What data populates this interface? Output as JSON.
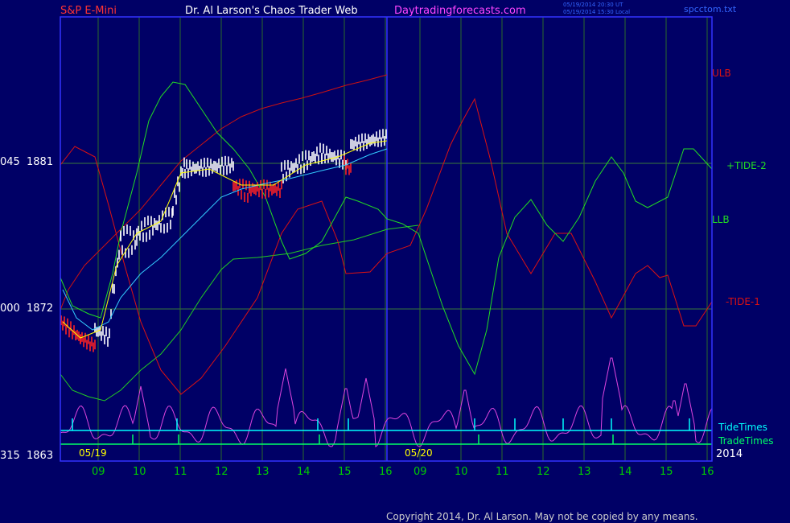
{
  "header": {
    "symbol": "S&P E-Mini",
    "site_title": "Dr. Al Larson's Chaos Trader Web",
    "site_url": "Daytradingforecasts.com",
    "timestamp_line1": "05/19/2014 20:30 UT",
    "timestamp_line2": "05/19/2014 15:30 Local",
    "file_name": "spcctom.txt"
  },
  "footer": {
    "copyright": "Copyright 2014, Dr. Al Larson. May not be copied by any means."
  },
  "colors": {
    "background": "#000066",
    "frame": "#3333ff",
    "grid_h": "#3a7a3a",
    "grid_v": "#2a6a2a",
    "axis_label": "#ffffff",
    "date_label": "#ffff00",
    "hour_label": "#00cc00",
    "ulb": "#dd1111",
    "tide2": "#22dd22",
    "llb": "#22dd22",
    "tide1": "#dd1111",
    "upper_band": "#cc1111",
    "lower_band": "#22cc22",
    "ma": "#33ccff",
    "ma_fast": "#ffff00",
    "bar_up": "#ffffff",
    "bar_down": "#ff2222",
    "energy": "#dd44dd",
    "tide_times": "#00ffff",
    "trade_times": "#00ff66",
    "symbol_text": "#ff3333",
    "site_title_text": "#ffffff",
    "site_url_text": "#ff44ff",
    "timestamp_text": "#3366ff",
    "copyright_text": "#cccccc"
  },
  "chart_data": {
    "type": "line",
    "title": "S&P E-Mini",
    "y_axis_labels": [
      {
        "code": "045",
        "price": "1881"
      },
      {
        "code": "000",
        "price": "1872"
      },
      {
        "code": "315",
        "price": "1863"
      }
    ],
    "x_hour_ticks": [
      "09",
      "10",
      "11",
      "12",
      "13",
      "14",
      "15",
      "16",
      "09",
      "10",
      "11",
      "12",
      "13",
      "14",
      "15",
      "16"
    ],
    "date_labels": [
      "05/19",
      "05/20"
    ],
    "year_label": "2014",
    "series_labels": [
      {
        "key": "ulb",
        "label": "ULB"
      },
      {
        "key": "tide2",
        "label": "+TIDE-2"
      },
      {
        "key": "llb",
        "label": "LLB"
      },
      {
        "key": "tide1",
        "label": "-TIDE-1"
      }
    ],
    "timing_labels": {
      "tide": "TideTimes",
      "trade": "TradeTimes"
    },
    "grid": true
  }
}
